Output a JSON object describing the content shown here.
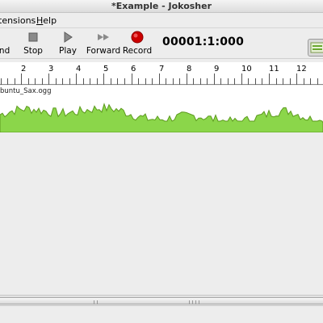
{
  "window": {
    "title": "*Example - Jokosher"
  },
  "menu": {
    "extensions": {
      "label_visible": "tensions"
    },
    "help": {
      "underline": "H",
      "rest": "elp"
    }
  },
  "toolbar": {
    "rewind_label_visible": "ind",
    "stop_label": "Stop",
    "play_label": "Play",
    "forward_label": "Forward",
    "record_label": "Record",
    "time_counter": "00001:1:000"
  },
  "timeline": {
    "bar_numbers": [
      "2",
      "3",
      "4",
      "5",
      "6",
      "7",
      "8",
      "9",
      "10",
      "11",
      "12"
    ]
  },
  "track": {
    "clip_name": "buntu_Sax.ogg",
    "waveform_color": "#8bd64a",
    "waveform_outline": "#5c9a1e"
  },
  "colors": {
    "record": "#cc0000",
    "icon_gray": "#6d6d6d"
  }
}
